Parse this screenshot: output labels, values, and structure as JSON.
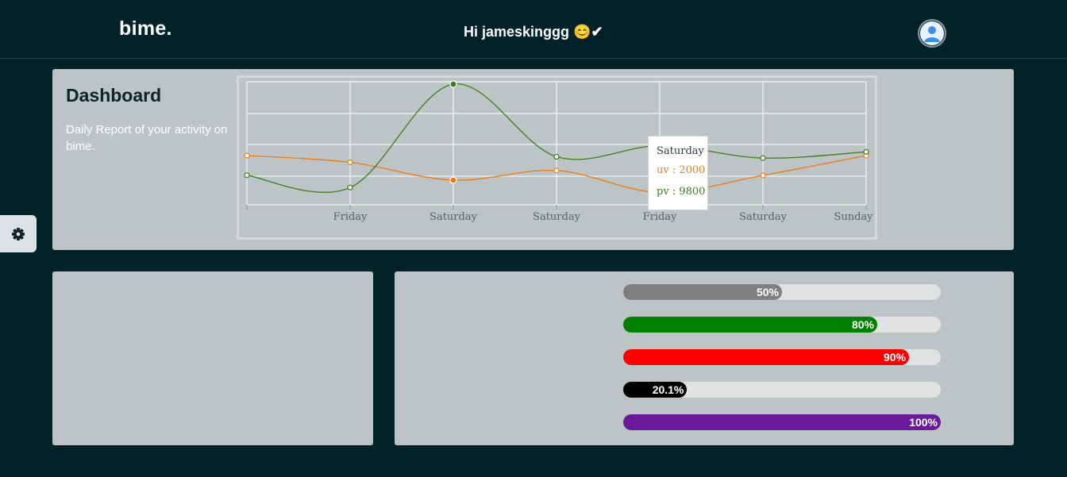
{
  "header": {
    "logo": "bime.",
    "greeting": "Hi jameskinggg 😊✔"
  },
  "dashboard": {
    "title": "Dashboard",
    "subtitle": "Daily Report of your activity on bime."
  },
  "chart_data": {
    "type": "line",
    "categories": [
      "",
      "Friday",
      "Saturday",
      "Saturday",
      "Friday",
      "Saturday",
      "Sunday"
    ],
    "series": [
      {
        "name": "uv",
        "color": "#f07a12",
        "values": [
          4000,
          3450,
          2000,
          2780,
          1000,
          2390,
          4000
        ]
      },
      {
        "name": "pv",
        "color": "#3a7d1a",
        "values": [
          2400,
          1398,
          9800,
          3908,
          4800,
          3800,
          4300
        ]
      }
    ],
    "tooltip": {
      "label": "Saturday",
      "uv": "uv : 2000",
      "pv": "pv : 9800"
    }
  },
  "progress": [
    {
      "label": "50%",
      "value": 0.5,
      "color": "#7f7f7f"
    },
    {
      "label": "80%",
      "value": 0.8,
      "color": "#008000"
    },
    {
      "label": "90%",
      "value": 0.9,
      "color": "#ff0000"
    },
    {
      "label": "20.1%",
      "value": 0.201,
      "color": "#000000"
    },
    {
      "label": "100%",
      "value": 1.0,
      "color": "#6a1b9a"
    }
  ],
  "icons": {
    "settings": "gear-icon",
    "avatar": "user-avatar-icon"
  }
}
